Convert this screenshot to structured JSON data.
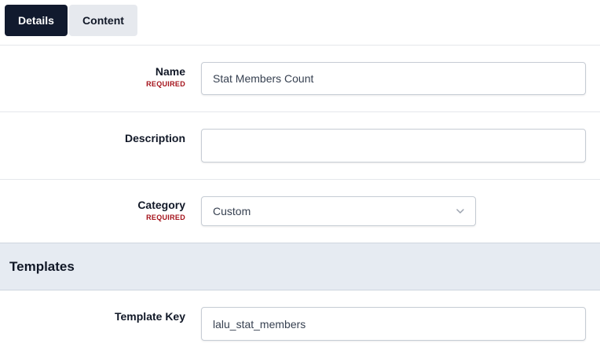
{
  "tabs": [
    {
      "label": "Details",
      "active": true
    },
    {
      "label": "Content",
      "active": false
    }
  ],
  "form": {
    "name": {
      "label": "Name",
      "required": "REQUIRED",
      "value": "Stat Members Count"
    },
    "description": {
      "label": "Description",
      "value": ""
    },
    "category": {
      "label": "Category",
      "required": "REQUIRED",
      "value": "Custom",
      "icon": "chevron-down-icon"
    }
  },
  "templates": {
    "heading": "Templates",
    "template_key": {
      "label": "Template Key",
      "value": "lalu_stat_members"
    }
  },
  "colors": {
    "active_tab": "#111a2e",
    "inactive_tab": "#e6e9ee",
    "required": "#a4121a",
    "section_bg": "#e6ebf2"
  }
}
